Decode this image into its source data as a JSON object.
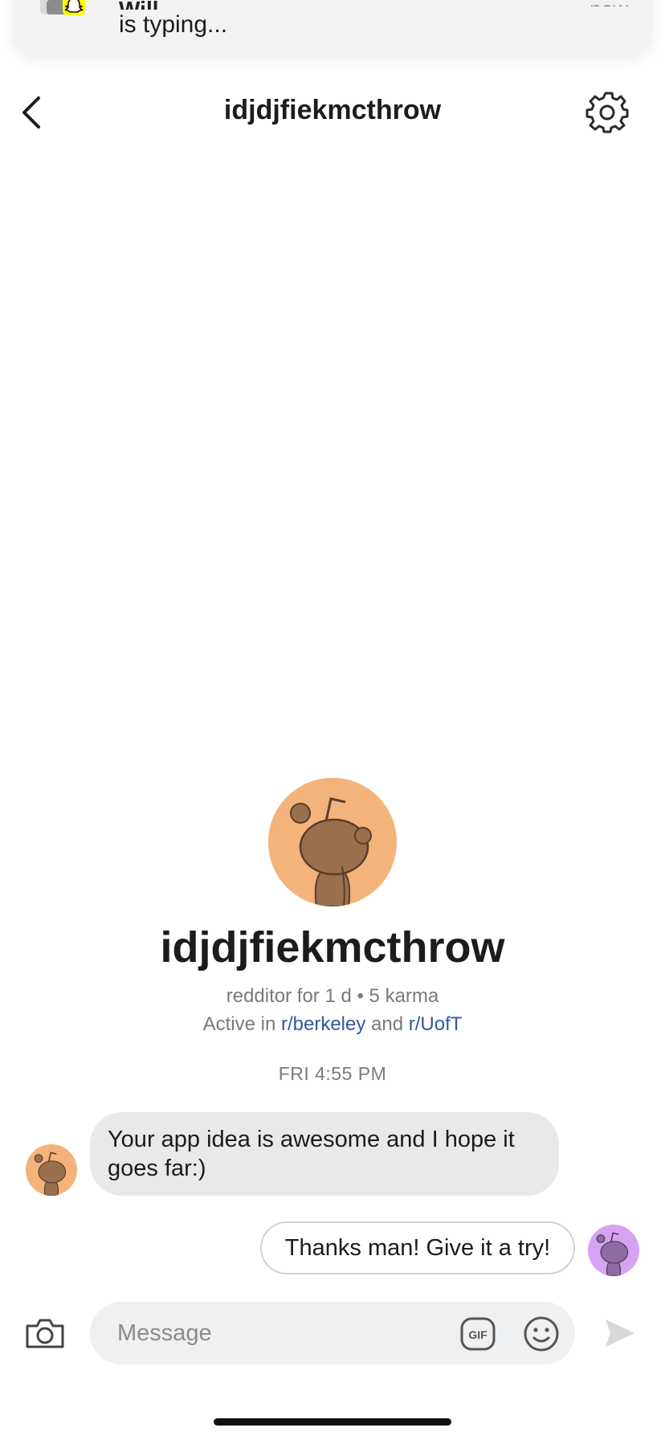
{
  "notification": {
    "app_icon": "snapchat-ghost-icon",
    "sender": "Will",
    "time": "now",
    "text": "is typing..."
  },
  "header": {
    "title": "idjdjfiekmcthrow",
    "back_icon": "chevron-left-icon",
    "settings_icon": "gear-icon"
  },
  "profile": {
    "username": "idjdjfiekmcthrow",
    "meta": "redditor for 1 d • 5 karma",
    "active_prefix": "Active in ",
    "active_sub1": "r/berkeley",
    "active_and": " and ",
    "active_sub2": "r/UofT",
    "avatar_color": "#f4b37a"
  },
  "conversation": {
    "timestamp": "FRI 4:55 PM",
    "messages": [
      {
        "from": "them",
        "text": "Your app idea is awesome and I hope it goes far:)",
        "avatar_color": "#f4b37a"
      },
      {
        "from": "me",
        "text": "Thanks man! Give it a try!",
        "avatar_color": "#d6a3f2"
      }
    ]
  },
  "composer": {
    "placeholder": "Message",
    "camera_icon": "camera-icon",
    "gif_label": "GIF",
    "emoji_icon": "smiley-icon",
    "send_icon": "send-icon"
  },
  "colors": {
    "link": "#33589e",
    "incoming_bubble": "#e8e9eb",
    "composer_bg": "#eef0f2"
  }
}
